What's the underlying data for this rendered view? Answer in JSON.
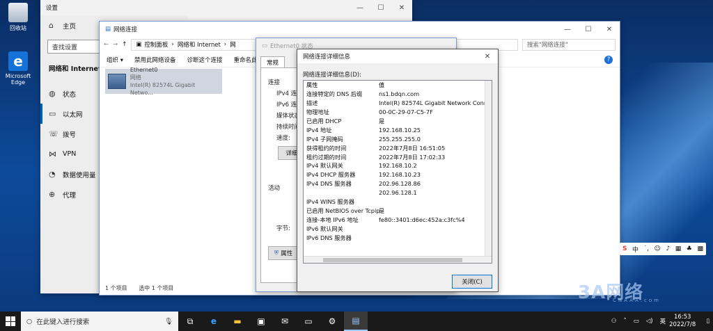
{
  "desktop": {
    "icons": [
      {
        "label": "回收站",
        "icon": "recycle-bin-icon"
      },
      {
        "label": "Microsoft Edge",
        "icon": "edge-icon"
      }
    ]
  },
  "settings": {
    "title": "设置",
    "home": "主页",
    "search_placeholder": "查找设置",
    "section": "网络和 Internet",
    "items": [
      {
        "label": "状态",
        "icon": "globe-icon"
      },
      {
        "label": "以太网",
        "icon": "ethernet-icon"
      },
      {
        "label": "拨号",
        "icon": "dialup-icon"
      },
      {
        "label": "VPN",
        "icon": "vpn-icon"
      },
      {
        "label": "数据使用量",
        "icon": "data-usage-icon"
      },
      {
        "label": "代理",
        "icon": "proxy-icon"
      }
    ]
  },
  "explorer": {
    "title": "网络连接",
    "breadcrumb": [
      "控制面板",
      "网络和 Internet",
      "网"
    ],
    "search_placeholder": "搜索\"网络连接\"",
    "commands": [
      "组织 ▾",
      "禁用此网络设备",
      "诊断这个连接",
      "重命名此"
    ],
    "adapter": {
      "name": "Ethernet0",
      "type": "网络",
      "device": "Intel(R) 82574L Gigabit Netwo..."
    },
    "status_left": "1 个项目",
    "status_selected": "选中 1 个项目"
  },
  "status_dialog": {
    "title": "Ethernet0 状态",
    "tab": "常规",
    "section_connection": "连接",
    "labels": [
      "IPv4 连接",
      "IPv6 连接",
      "媒体状态",
      "持续时间",
      "速度:"
    ],
    "details_button": "详细",
    "section_activity": "活动",
    "bytes_label": "字节:",
    "properties_button": "属性"
  },
  "details_dialog": {
    "title": "网络连接详细信息",
    "caption": "网络连接详细信息(D):",
    "header": {
      "k": "属性",
      "v": "值"
    },
    "rows": [
      {
        "k": "连接特定的 DNS 后缀",
        "v": "ns1.bdqn.com"
      },
      {
        "k": "描述",
        "v": "Intel(R) 82574L Gigabit Network Connect"
      },
      {
        "k": "物理地址",
        "v": "00-0C-29-07-C5-7F"
      },
      {
        "k": "已启用 DHCP",
        "v": "是"
      },
      {
        "k": "IPv4 地址",
        "v": "192.168.10.25"
      },
      {
        "k": "IPv4 子网掩码",
        "v": "255.255.255.0"
      },
      {
        "k": "获得租约的时间",
        "v": "2022年7月8日 16:51:05"
      },
      {
        "k": "租约过期的时间",
        "v": "2022年7月8日 17:02:33"
      },
      {
        "k": "IPv4 默认网关",
        "v": "192.168.10.2"
      },
      {
        "k": "IPv4 DHCP 服务器",
        "v": "192.168.10.23"
      },
      {
        "k": "IPv4 DNS 服务器",
        "v": "202.96.128.86"
      },
      {
        "k": "",
        "v": "202.96.128.1"
      },
      {
        "k": "IPv4 WINS 服务器",
        "v": ""
      },
      {
        "k": "已启用 NetBIOS over Tcpip",
        "v": "是"
      },
      {
        "k": "连接-本地 IPv6 地址",
        "v": "fe80::3401:d6ec:452a:c3fc%4"
      },
      {
        "k": "IPv6 默认网关",
        "v": ""
      },
      {
        "k": "IPv6 DNS 服务器",
        "v": ""
      }
    ],
    "close_button": "关闭(C)"
  },
  "ime": {
    "label": "中"
  },
  "taskbar": {
    "search_placeholder": "在此键入进行搜索",
    "tray_lang": "英",
    "time": "16:53",
    "date": "2022/7/8"
  },
  "watermark": {
    "text": "3A网络",
    "sub": "CNAAA.com"
  }
}
